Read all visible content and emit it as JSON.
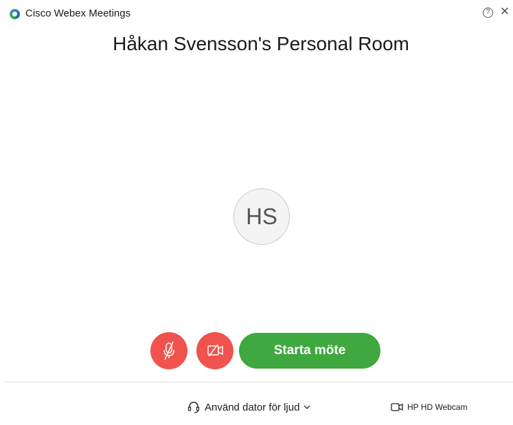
{
  "window": {
    "app_title": "Cisco Webex Meetings",
    "help_icon": "question-circle-icon",
    "close_label": "✕"
  },
  "room": {
    "title": "Håkan Svensson's Personal Room",
    "avatar_initials": "HS"
  },
  "controls": {
    "mute_icon": "microphone-muted-icon",
    "video_icon": "video-off-icon",
    "start_label": "Starta möte"
  },
  "footer": {
    "audio_label": "Använd dator för ljud",
    "camera_label": "HP HD Webcam"
  },
  "colors": {
    "danger": "#f0524d",
    "start": "#3fa83f",
    "avatar_bg": "#f4f4f4"
  }
}
